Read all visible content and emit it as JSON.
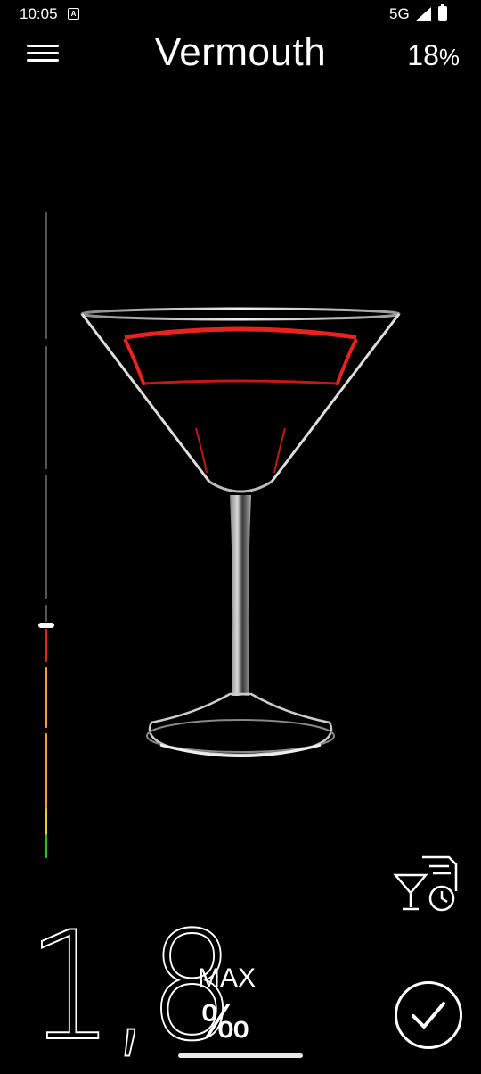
{
  "status_bar": {
    "time": "10:05",
    "network": "5G"
  },
  "header": {
    "title": "Vermouth",
    "percent_value": "18",
    "percent_unit": "%"
  },
  "level_bar": {
    "current_fraction": 0.36
  },
  "reading": {
    "value": "1,8",
    "max_label": "MAX",
    "unit": "‰"
  },
  "icons": {
    "menu": "hamburger-menu-icon",
    "history": "drink-history-icon",
    "confirm": "checkmark-icon"
  },
  "colors": {
    "red": "#e8231e",
    "orange": "#f2a12e",
    "yellow": "#e6d520",
    "green": "#2dc21a",
    "track": "#555555"
  }
}
